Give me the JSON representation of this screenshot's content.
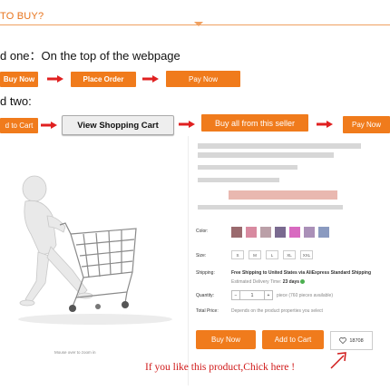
{
  "header": {
    "title": "TO BUY?"
  },
  "method_one": {
    "label": "d one：On the top of the webpage",
    "buttons": {
      "buy_now": "Buy Now",
      "place_order": "Place Order",
      "pay_now": "Pay Now"
    }
  },
  "method_two": {
    "label": "d two:",
    "buttons": {
      "add_to_cart": "d to Cart",
      "view_cart": "View Shopping Cart",
      "buy_all": "Buy all from this seller",
      "pay_now": "Pay Now"
    }
  },
  "product": {
    "color_label": "Color:",
    "size_label": "Size:",
    "sizes": [
      "S",
      "M",
      "L",
      "XL",
      "XXL"
    ],
    "shipping_label": "Shipping:",
    "shipping_text": "Free Shipping to United States via AliExpress Standard Shipping",
    "delivery_prefix": "Estimated Delivery Time:",
    "delivery_days": "23 days",
    "quantity_label": "Quantity:",
    "quantity_minus": "−",
    "quantity_value": "1",
    "quantity_plus": "+",
    "pieces_note": "piece (760 pieces available)",
    "total_label": "Total Price:",
    "total_text": "Depends on the product properties you select",
    "buy_now": "Buy Now",
    "add_to_cart": "Add to Cart",
    "wishlist_count": "18708",
    "zoom_hint": "Mouse over to zoom in"
  },
  "note": "If you like this product,Chick here !",
  "colors": {
    "accent": "#f07b1c",
    "note_red": "#d01a1a",
    "swatches": [
      "#9a6a6e",
      "#d88aa0",
      "#bba0a8",
      "#7a6a90",
      "#d86ac0",
      "#aa90b8",
      "#8a9ac0"
    ]
  }
}
